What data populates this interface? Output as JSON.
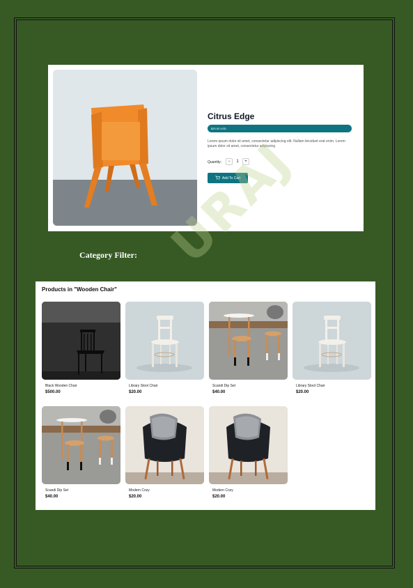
{
  "watermark": "URAJ",
  "product": {
    "title": "Citrus Edge",
    "price": "$20.00 USD",
    "description": "Lorem ipsum dolor sit amet, consectetur adipiscing elit. Nullam tincidunt erat enim. Lorem ipsum dolor sit amet, consectetur adipiscing",
    "quantity_label": "Quantity:",
    "quantity_value": "1",
    "minus_label": "−",
    "plus_label": "+",
    "add_to_cart_label": "Add To Cart",
    "accent": "#0e7482",
    "image_icon": "orange-chair-image"
  },
  "category_filter_label": "Category Filter:",
  "listing": {
    "heading": "Products in \"Wooden Chair\"",
    "items": [
      {
        "name": "Black Wooden Chair",
        "price": "$500.00",
        "icon": "black-wooden-chair-image"
      },
      {
        "name": "Library Stool Chair",
        "price": "$20.00",
        "icon": "white-bistro-chair-image"
      },
      {
        "name": "Scandi Dip Set",
        "price": "$40.00",
        "icon": "stool-table-set-image"
      },
      {
        "name": "Library Stool Chair",
        "price": "$20.00",
        "icon": "white-bistro-chair-image"
      },
      {
        "name": "Scandi Dip Set",
        "price": "$40.00",
        "icon": "stool-table-set-image"
      },
      {
        "name": "Modern Cozy",
        "price": "$20.00",
        "icon": "black-lounge-chair-image"
      },
      {
        "name": "Modern Cozy",
        "price": "$20.00",
        "icon": "black-lounge-chair-image"
      }
    ]
  },
  "colors": {
    "page_background": "#375a25",
    "button": "#0e7482"
  }
}
